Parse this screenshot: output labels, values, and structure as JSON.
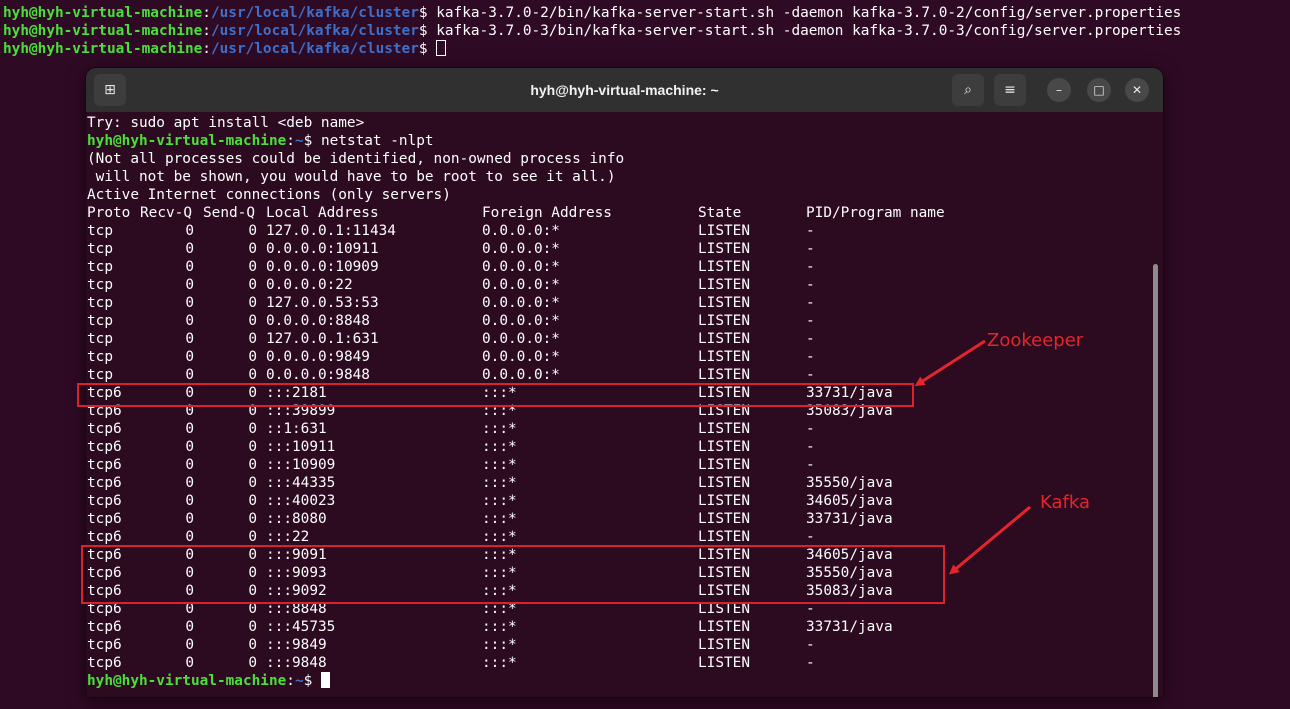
{
  "background_terminal": {
    "lines": [
      {
        "user": "hyh@hyh-virtual-machine",
        "colon": ":",
        "path": "/usr/local/kafka/cluster",
        "prompt": "$ ",
        "cmd": "kafka-3.7.0-2/bin/kafka-server-start.sh -daemon kafka-3.7.0-2/config/server.properties"
      },
      {
        "user": "hyh@hyh-virtual-machine",
        "colon": ":",
        "path": "/usr/local/kafka/cluster",
        "prompt": "$ ",
        "cmd": "kafka-3.7.0-3/bin/kafka-server-start.sh -daemon kafka-3.7.0-3/config/server.properties"
      },
      {
        "user": "hyh@hyh-virtual-machine",
        "colon": ":",
        "path": "/usr/local/kafka/cluster",
        "prompt": "$ ",
        "cmd": ""
      }
    ]
  },
  "window": {
    "title": "hyh@hyh-virtual-machine: ~",
    "icons": {
      "new_tab": "new-tab-icon",
      "search": "search-icon",
      "menu": "hamburger-menu-icon",
      "minimize": "minimize-icon",
      "maximize": "maximize-icon",
      "close": "close-icon"
    },
    "glyphs": {
      "new_tab": "⊞",
      "search": "⌕",
      "menu": "≡",
      "minimize": "–",
      "maximize": "□",
      "close": "✕"
    }
  },
  "terminal": {
    "intro": [
      "Try: sudo apt install <deb name>"
    ],
    "prompt_user": "hyh@hyh-virtual-machine",
    "prompt_colon": ":",
    "prompt_path": "~",
    "prompt_sign": "$ ",
    "command": "netstat -nlpt",
    "notice": [
      "(Not all processes could be identified, non-owned process info",
      " will not be shown, you would have to be root to see it all.)",
      "Active Internet connections (only servers)"
    ],
    "header": {
      "proto": "Proto",
      "recvq": "Recv-Q",
      "sendq": "Send-Q",
      "local": "Local Address",
      "foreign": "Foreign Address",
      "state": "State",
      "pid": "PID/Program name"
    },
    "rows": [
      {
        "proto": "tcp",
        "recvq": "0",
        "sendq": "0",
        "local": "127.0.0.1:11434",
        "foreign": "0.0.0.0:*",
        "state": "LISTEN",
        "pid": "-"
      },
      {
        "proto": "tcp",
        "recvq": "0",
        "sendq": "0",
        "local": "0.0.0.0:10911",
        "foreign": "0.0.0.0:*",
        "state": "LISTEN",
        "pid": "-"
      },
      {
        "proto": "tcp",
        "recvq": "0",
        "sendq": "0",
        "local": "0.0.0.0:10909",
        "foreign": "0.0.0.0:*",
        "state": "LISTEN",
        "pid": "-"
      },
      {
        "proto": "tcp",
        "recvq": "0",
        "sendq": "0",
        "local": "0.0.0.0:22",
        "foreign": "0.0.0.0:*",
        "state": "LISTEN",
        "pid": "-"
      },
      {
        "proto": "tcp",
        "recvq": "0",
        "sendq": "0",
        "local": "127.0.0.53:53",
        "foreign": "0.0.0.0:*",
        "state": "LISTEN",
        "pid": "-"
      },
      {
        "proto": "tcp",
        "recvq": "0",
        "sendq": "0",
        "local": "0.0.0.0:8848",
        "foreign": "0.0.0.0:*",
        "state": "LISTEN",
        "pid": "-"
      },
      {
        "proto": "tcp",
        "recvq": "0",
        "sendq": "0",
        "local": "127.0.0.1:631",
        "foreign": "0.0.0.0:*",
        "state": "LISTEN",
        "pid": "-"
      },
      {
        "proto": "tcp",
        "recvq": "0",
        "sendq": "0",
        "local": "0.0.0.0:9849",
        "foreign": "0.0.0.0:*",
        "state": "LISTEN",
        "pid": "-"
      },
      {
        "proto": "tcp",
        "recvq": "0",
        "sendq": "0",
        "local": "0.0.0.0:9848",
        "foreign": "0.0.0.0:*",
        "state": "LISTEN",
        "pid": "-"
      },
      {
        "proto": "tcp6",
        "recvq": "0",
        "sendq": "0",
        "local": ":::2181",
        "foreign": ":::*",
        "state": "LISTEN",
        "pid": "33731/java"
      },
      {
        "proto": "tcp6",
        "recvq": "0",
        "sendq": "0",
        "local": ":::39899",
        "foreign": ":::*",
        "state": "LISTEN",
        "pid": "35083/java"
      },
      {
        "proto": "tcp6",
        "recvq": "0",
        "sendq": "0",
        "local": "::1:631",
        "foreign": ":::*",
        "state": "LISTEN",
        "pid": "-"
      },
      {
        "proto": "tcp6",
        "recvq": "0",
        "sendq": "0",
        "local": ":::10911",
        "foreign": ":::*",
        "state": "LISTEN",
        "pid": "-"
      },
      {
        "proto": "tcp6",
        "recvq": "0",
        "sendq": "0",
        "local": ":::10909",
        "foreign": ":::*",
        "state": "LISTEN",
        "pid": "-"
      },
      {
        "proto": "tcp6",
        "recvq": "0",
        "sendq": "0",
        "local": ":::44335",
        "foreign": ":::*",
        "state": "LISTEN",
        "pid": "35550/java"
      },
      {
        "proto": "tcp6",
        "recvq": "0",
        "sendq": "0",
        "local": ":::40023",
        "foreign": ":::*",
        "state": "LISTEN",
        "pid": "34605/java"
      },
      {
        "proto": "tcp6",
        "recvq": "0",
        "sendq": "0",
        "local": ":::8080",
        "foreign": ":::*",
        "state": "LISTEN",
        "pid": "33731/java"
      },
      {
        "proto": "tcp6",
        "recvq": "0",
        "sendq": "0",
        "local": ":::22",
        "foreign": ":::*",
        "state": "LISTEN",
        "pid": "-"
      },
      {
        "proto": "tcp6",
        "recvq": "0",
        "sendq": "0",
        "local": ":::9091",
        "foreign": ":::*",
        "state": "LISTEN",
        "pid": "34605/java"
      },
      {
        "proto": "tcp6",
        "recvq": "0",
        "sendq": "0",
        "local": ":::9093",
        "foreign": ":::*",
        "state": "LISTEN",
        "pid": "35550/java"
      },
      {
        "proto": "tcp6",
        "recvq": "0",
        "sendq": "0",
        "local": ":::9092",
        "foreign": ":::*",
        "state": "LISTEN",
        "pid": "35083/java"
      },
      {
        "proto": "tcp6",
        "recvq": "0",
        "sendq": "0",
        "local": ":::8848",
        "foreign": ":::*",
        "state": "LISTEN",
        "pid": "-"
      },
      {
        "proto": "tcp6",
        "recvq": "0",
        "sendq": "0",
        "local": ":::45735",
        "foreign": ":::*",
        "state": "LISTEN",
        "pid": "33731/java"
      },
      {
        "proto": "tcp6",
        "recvq": "0",
        "sendq": "0",
        "local": ":::9849",
        "foreign": ":::*",
        "state": "LISTEN",
        "pid": "-"
      },
      {
        "proto": "tcp6",
        "recvq": "0",
        "sendq": "0",
        "local": ":::9848",
        "foreign": ":::*",
        "state": "LISTEN",
        "pid": "-"
      }
    ]
  },
  "annotations": {
    "zookeeper_label": "Zookeeper",
    "kafka_label": "Kafka"
  },
  "colors": {
    "background": "#2f0a24",
    "terminal_bg": "#2c0a20",
    "user": "#4ae03a",
    "path": "#3f6fc9",
    "annotation_red": "#d8222c",
    "titlebar": "#303030"
  }
}
